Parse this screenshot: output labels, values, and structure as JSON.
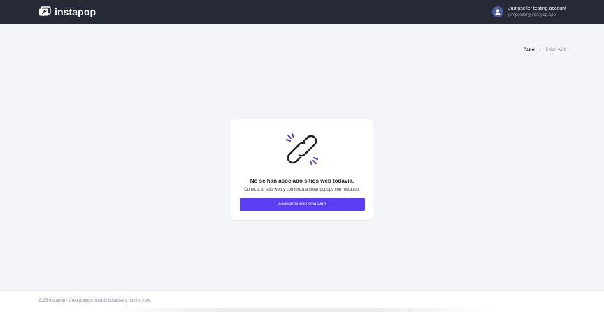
{
  "header": {
    "brand_name": "instapop",
    "account": {
      "name": "Jumpseller testing account",
      "email": "jumpseller@instapop.app"
    }
  },
  "breadcrumb": {
    "items": [
      {
        "label": "Panel"
      },
      {
        "label": "Sitios web"
      }
    ],
    "separator": "›"
  },
  "empty_state": {
    "icon": "broken-link-icon",
    "title": "No se han asociado sitios web todavía.",
    "subtitle": "Conecta tu sitio web y comienza a crear popups con Instapop.",
    "button_label": "Asociar nuevo sitio web"
  },
  "footer": {
    "text": "2025 Instapop - Crea popups, barras flotantes y mucho más."
  },
  "colors": {
    "header_bg": "#262a36",
    "page_bg": "#f4f5f8",
    "accent": "#5b3df2",
    "icon_dark": "#1f2330"
  }
}
